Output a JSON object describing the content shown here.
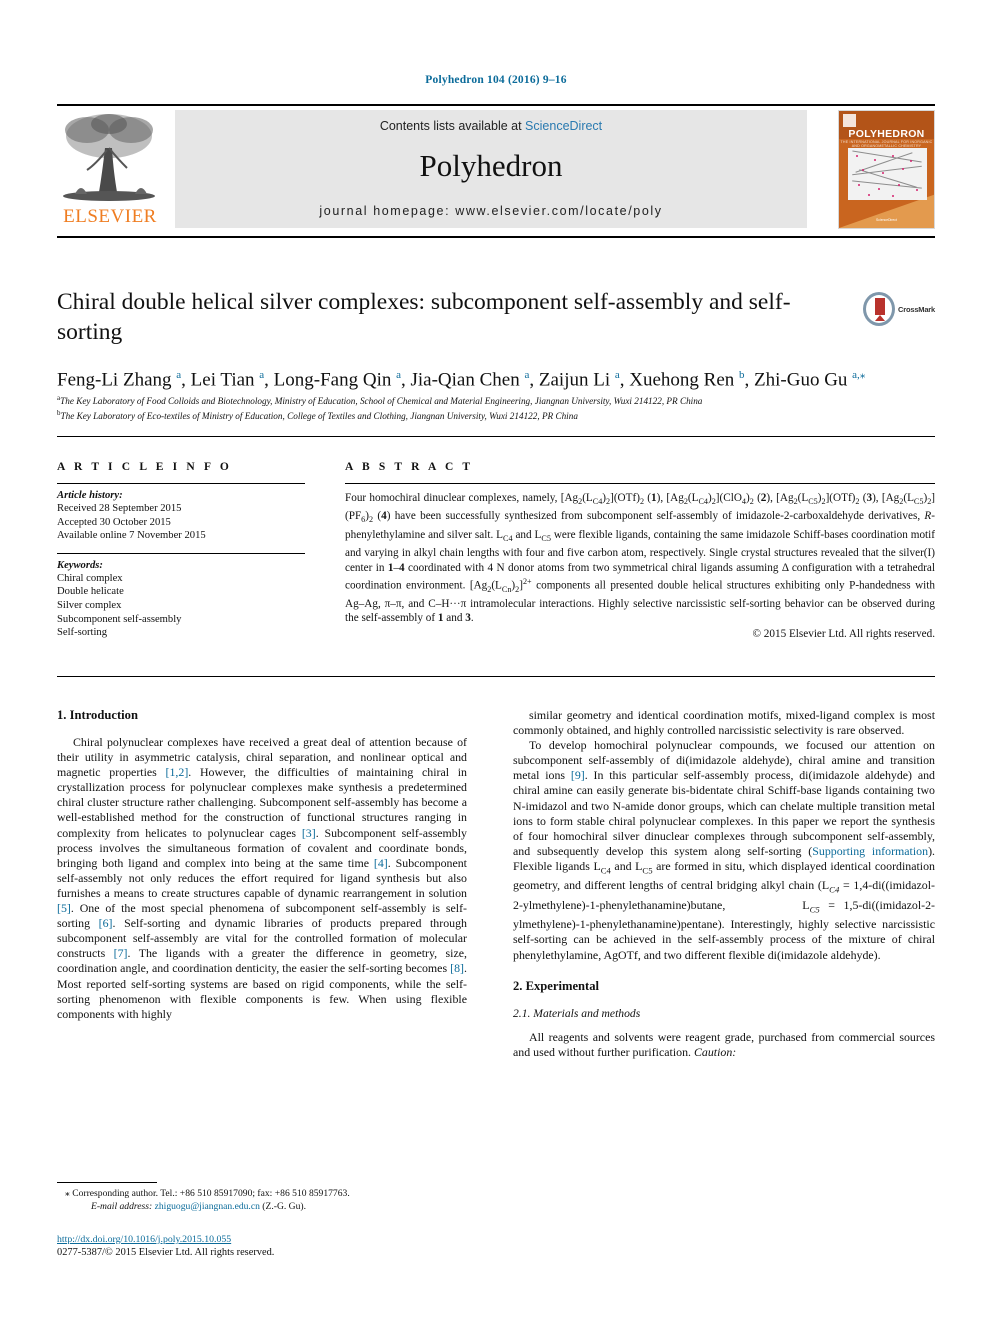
{
  "running_head": "Polyhedron 104 (2016) 9–16",
  "masthead": {
    "publisher_name": "ELSEVIER",
    "contents_prefix": "Contents lists available at ",
    "contents_link": "ScienceDirect",
    "journal_title": "Polyhedron",
    "homepage": "journal homepage: www.elsevier.com/locate/poly",
    "cover": {
      "title": "POLYHEDRON",
      "subtitle": "THE INTERNATIONAL JOURNAL FOR INORGANIC AND ORGANOMETALLIC CHEMISTRY",
      "footer": "ScienceDirect"
    }
  },
  "article": {
    "title": "Chiral double helical silver complexes: subcomponent self-assembly and self-sorting",
    "crossmark_label": "CrossMark",
    "authors_html": "Feng-Li Zhang <sup>a</sup>, Lei Tian <sup>a</sup>, Long-Fang Qin <sup>a</sup>, Jia-Qian Chen <sup>a</sup>, Zaijun Li <sup>a</sup>, Xuehong Ren <sup>b</sup>, Zhi-Guo Gu <sup>a,</sup><sup class=\"star\">⁎</sup>",
    "affiliation_a": "The Key Laboratory of Food Colloids and Biotechnology, Ministry of Education, School of Chemical and Material Engineering, Jiangnan University, Wuxi 214122, PR China",
    "affiliation_b": "The Key Laboratory of Eco-textiles of Ministry of Education, College of Textiles and Clothing, Jiangnan University, Wuxi 214122, PR China",
    "affiliation_a_marker": "a",
    "affiliation_b_marker": "b"
  },
  "info": {
    "heading": "A R T I C L E   I N F O",
    "history_label": "Article history:",
    "history": [
      "Received 28 September 2015",
      "Accepted 30 October 2015",
      "Available online 7 November 2015"
    ],
    "keywords_label": "Keywords:",
    "keywords": [
      "Chiral complex",
      "Double helicate",
      "Silver complex",
      "Subcomponent self-assembly",
      "Self-sorting"
    ]
  },
  "abstract": {
    "heading": "A B S T R A C T",
    "body_html": "Four homochiral dinuclear complexes, namely, [Ag<sub>2</sub>(L<sub>C4</sub>)<sub>2</sub>](OTf)<sub>2</sub> (<b>1</b>), [Ag<sub>2</sub>(L<sub>C4</sub>)<sub>2</sub>](ClO<sub>4</sub>)<sub>2</sub> (<b>2</b>), [Ag<sub>2</sub>(L<sub>C5</sub>)<sub>2</sub>](OTf)<sub>2</sub> (<b>3</b>), [Ag<sub>2</sub>(L<sub>C5</sub>)<sub>2</sub>](PF<sub>6</sub>)<sub>2</sub> (<b>4</b>) have been successfully synthesized from subcomponent self-assembly of imidazole-2-carboxaldehyde derivatives, <i>R</i>-phenylethylamine and silver salt. L<sub>C4</sub> and L<sub>C5</sub> were flexible ligands, containing the same imidazole Schiff-bases coordination motif and varying in alkyl chain lengths with four and five carbon atom, respectively. Single crystal structures revealed that the silver(I) center in <b>1</b>–<b>4</b> coordinated with 4 N donor atoms from two symmetrical chiral ligands assuming Δ configuration with a tetrahedral coordination environment. [Ag<sub>2</sub>(L<sub>Cn</sub>)<sub>2</sub>]<sup>2+</sup> components all presented double helical structures exhibiting only P-handedness with Ag–Ag, π–π, and C–H···π intramolecular interactions. Highly selective narcissistic self-sorting behavior can be observed during the self-assembly of <b>1</b> and <b>3</b>.",
    "copyright": "© 2015 Elsevier Ltd. All rights reserved."
  },
  "sections": {
    "intro_heading": "1. Introduction",
    "intro_p1_html": "Chiral polynuclear complexes have received a great deal of attention because of their utility in asymmetric catalysis, chiral separation, and nonlinear optical and magnetic properties <span class=\"ref\">[1,2]</span>. However, the difficulties of maintaining chiral in crystallization process for polynuclear complexes make synthesis a predetermined chiral cluster structure rather challenging. Subcomponent self-assembly has become a well-established method for the construction of functional structures ranging in complexity from helicates to polynuclear cages <span class=\"ref\">[3]</span>. Subcomponent self-assembly process involves the simultaneous formation of covalent and coordinate bonds, bringing both ligand and complex into being at the same time <span class=\"ref\">[4]</span>. Subcomponent self-assembly not only reduces the effort required for ligand synthesis but also furnishes a means to create structures capable of dynamic rearrangement in solution <span class=\"ref\">[5]</span>. One of the most special phenomena of subcomponent self-assembly is self-sorting <span class=\"ref\">[6]</span>. Self-sorting and dynamic libraries of products prepared through subcomponent self-assembly are vital for the controlled formation of molecular constructs <span class=\"ref\">[7]</span>. The ligands with a greater the difference in geometry, size, coordination angle, and coordination denticity, the easier the self-sorting becomes <span class=\"ref\">[8]</span>. Most reported self-sorting systems are based on rigid components, while the self-sorting phenomenon with flexible components is few. When using flexible components with highly",
    "right_p1_html": "similar geometry and identical coordination motifs, mixed-ligand complex is most commonly obtained, and highly controlled narcissistic selectivity is rare observed.",
    "right_p2_html": "To develop homochiral polynuclear compounds, we focused our attention on subcomponent self-assembly of di(imidazole aldehyde), chiral amine and transition metal ions <span class=\"ref\">[9]</span>. In this particular self-assembly process, di(imidazole aldehyde) and chiral amine can easily generate bis-bidentate chiral Schiff-base ligands containing two N-imidazol and two N-amide donor groups, which can chelate multiple transition metal ions to form stable chiral polynuclear complexes. In this paper we report the synthesis of four homochiral silver dinuclear complexes through subcomponent self-assembly, and subsequently develop this system along self-sorting (<span class=\"link\">Supporting information</span>). Flexible ligands L<sub>C4</sub> and L<sub>C5</sub> are formed in situ, which displayed identical coordination geometry, and different lengths of central bridging alkyl chain (L<sub><i>C4</i></sub> = 1,4-di((imidazol-2-ylmethylene)-1-phenylethanamine)butane, &nbsp;&nbsp;&nbsp;&nbsp;&nbsp;&nbsp;&nbsp;&nbsp;L<sub><i>C5</i></sub> = 1,5-di((imidazol-2-ylmethylene)-1-phenylethanamine)pentane). Interestingly, highly selective narcissistic self-sorting can be achieved in the self-assembly process of the mixture of chiral phenylethylamine, AgOTf, and two different flexible di(imidazole aldehyde).",
    "exp_heading": "2. Experimental",
    "exp_subheading": "2.1. Materials and methods",
    "exp_p1_html": "All reagents and solvents were reagent grade, purchased from commercial sources and used without further purification. <i>Caution:</i>"
  },
  "footer": {
    "corr_marker": "⁎",
    "corresponding": "Corresponding author. Tel.: +86 510 85917090; fax: +86 510 85917763.",
    "email_label": "E-mail address:",
    "email": "zhiguogu@jiangnan.edu.cn",
    "email_suffix": "(Z.-G. Gu).",
    "doi": "http://dx.doi.org/10.1016/j.poly.2015.10.055",
    "issn": "0277-5387/© 2015 Elsevier Ltd. All rights reserved."
  },
  "colors": {
    "link": "#0b6b9a",
    "elsevier_orange": "#ef7d22",
    "banner_bg": "#e6e6e6"
  }
}
